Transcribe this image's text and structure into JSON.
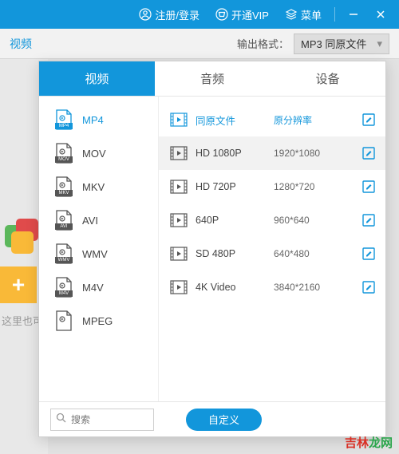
{
  "titlebar": {
    "login": "注册/登录",
    "vip": "开通VIP",
    "menu": "菜单"
  },
  "subbar": {
    "left_tab": "视频",
    "output_label": "输出格式：",
    "output_value": "MP3  同原文件"
  },
  "bg": {
    "drag_hint": "这里也可"
  },
  "panel": {
    "tabs": {
      "video": "视频",
      "audio": "音频",
      "device": "设备"
    },
    "formats": [
      {
        "label": "MP4",
        "ext": "MP4"
      },
      {
        "label": "MOV",
        "ext": "MOV"
      },
      {
        "label": "MKV",
        "ext": "MKV"
      },
      {
        "label": "AVI",
        "ext": "AVI"
      },
      {
        "label": "WMV",
        "ext": "WMV"
      },
      {
        "label": "M4V",
        "ext": "M4V"
      },
      {
        "label": "MPEG",
        "ext": ""
      }
    ],
    "resolutions": [
      {
        "label": "同原文件",
        "dim": "原分辨率",
        "original": true
      },
      {
        "label": "HD 1080P",
        "dim": "1920*1080",
        "selected": true
      },
      {
        "label": "HD 720P",
        "dim": "1280*720"
      },
      {
        "label": "640P",
        "dim": "960*640"
      },
      {
        "label": "SD 480P",
        "dim": "640*480"
      },
      {
        "label": "4K Video",
        "dim": "3840*2160"
      }
    ],
    "search_placeholder": "搜索",
    "custom_btn": "自定义"
  },
  "watermark": "吉林龙网"
}
